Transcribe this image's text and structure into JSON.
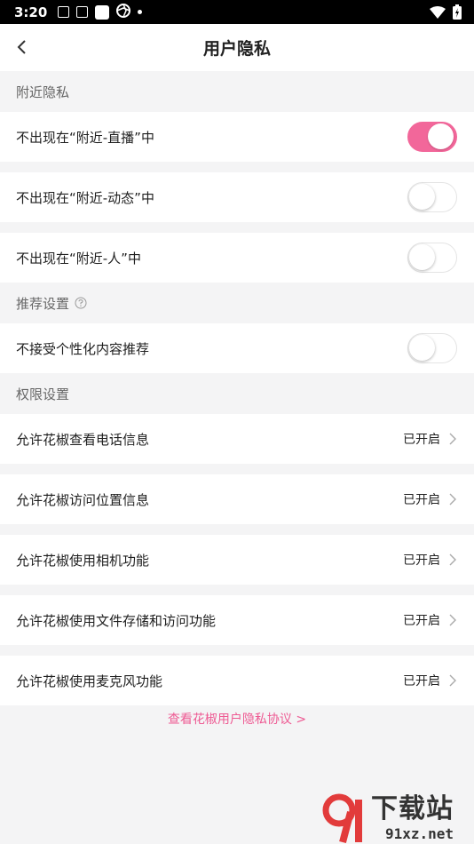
{
  "status_bar": {
    "time": "3:20"
  },
  "header": {
    "title": "用户隐私"
  },
  "sections": {
    "nearby": {
      "title": "附近隐私",
      "items": [
        {
          "label": "不出现在“附近-直播”中",
          "enabled": true
        },
        {
          "label": "不出现在“附近-动态”中",
          "enabled": false
        },
        {
          "label": "不出现在“附近-人”中",
          "enabled": false
        }
      ]
    },
    "recommend": {
      "title": "推荐设置",
      "items": [
        {
          "label": "不接受个性化内容推荐",
          "enabled": false
        }
      ]
    },
    "permissions": {
      "title": "权限设置",
      "items": [
        {
          "label": "允许花椒查看电话信息",
          "status": "已开启"
        },
        {
          "label": "允许花椒访问位置信息",
          "status": "已开启"
        },
        {
          "label": "允许花椒使用相机功能",
          "status": "已开启"
        },
        {
          "label": "允许花椒使用文件存储和访问功能",
          "status": "已开启"
        },
        {
          "label": "允许花椒使用麦克风功能",
          "status": "已开启"
        }
      ]
    }
  },
  "footer": {
    "policy_link": "查看花椒用户隐私协议 >"
  },
  "watermark": {
    "main": "下载站",
    "domain": "91xz.net"
  },
  "colors": {
    "accent": "#f2679a",
    "link": "#ee5a93"
  }
}
